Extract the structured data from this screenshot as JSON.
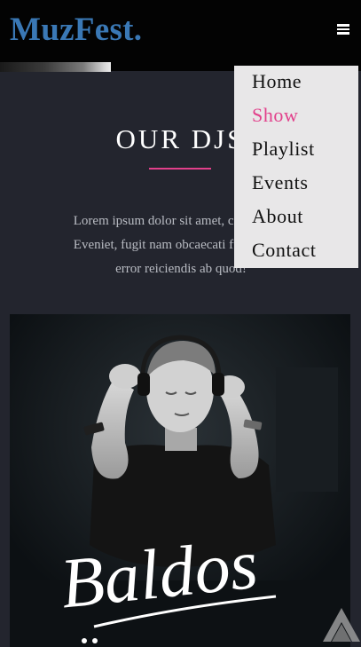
{
  "header": {
    "logo": "MuzFest.",
    "menu_icon": "hamburger-menu-icon"
  },
  "nav": {
    "items": [
      {
        "label": "Home",
        "active": false
      },
      {
        "label": "Show",
        "active": true
      },
      {
        "label": "Playlist",
        "active": false
      },
      {
        "label": "Events",
        "active": false
      },
      {
        "label": "About",
        "active": false
      },
      {
        "label": "Contact",
        "active": false
      }
    ]
  },
  "section": {
    "title": "OUR DJS",
    "intro_line1": "Lorem ipsum dolor sit amet, consectetur",
    "intro_line2": "Eveniet, fugit nam obcaecati fuga itaque",
    "intro_line3": "error reiciendis ab quod!"
  },
  "dj_card": {
    "signature_text": "Baldos",
    "photo_icon": "dj-photo-image"
  },
  "scroll_top": {
    "icon": "chevron-up-icon"
  },
  "colors": {
    "brand": "#3a78b5",
    "accent": "#e2408b",
    "header_bg": "#030303",
    "page_bg": "#23252e",
    "menu_bg": "#e8e7e8"
  }
}
